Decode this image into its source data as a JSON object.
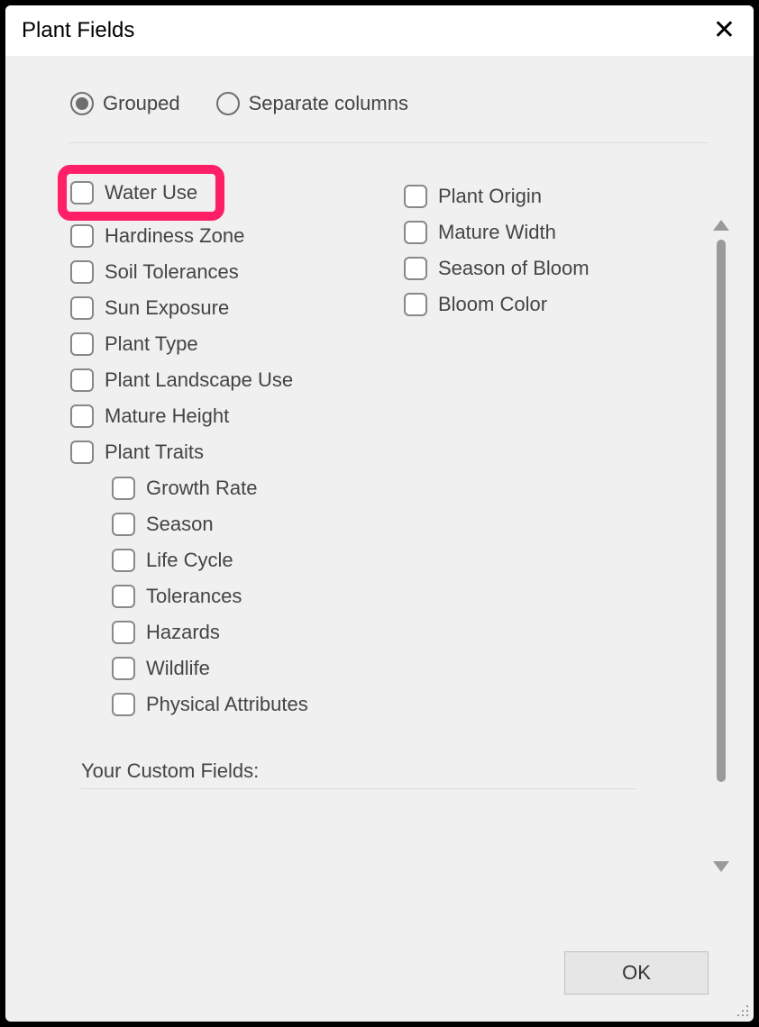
{
  "dialog": {
    "title": "Plant Fields"
  },
  "viewMode": {
    "options": [
      {
        "label": "Grouped",
        "selected": true
      },
      {
        "label": "Separate columns",
        "selected": false
      }
    ]
  },
  "fields": {
    "columnA": [
      {
        "label": "Water Use",
        "highlighted": true
      },
      {
        "label": "Hardiness Zone"
      },
      {
        "label": "Soil Tolerances"
      },
      {
        "label": "Sun Exposure"
      },
      {
        "label": "Plant Type"
      },
      {
        "label": "Plant Landscape Use"
      },
      {
        "label": "Mature Height"
      },
      {
        "label": "Plant Traits"
      }
    ],
    "columnA_nested": [
      {
        "label": "Growth Rate"
      },
      {
        "label": "Season"
      },
      {
        "label": "Life Cycle"
      },
      {
        "label": "Tolerances"
      },
      {
        "label": "Hazards"
      },
      {
        "label": "Wildlife"
      },
      {
        "label": "Physical Attributes"
      }
    ],
    "columnB": [
      {
        "label": "Plant Origin"
      },
      {
        "label": "Mature Width"
      },
      {
        "label": "Season of Bloom"
      },
      {
        "label": "Bloom Color"
      }
    ]
  },
  "customSection": {
    "label": "Your Custom Fields:"
  },
  "buttons": {
    "ok": "OK"
  }
}
